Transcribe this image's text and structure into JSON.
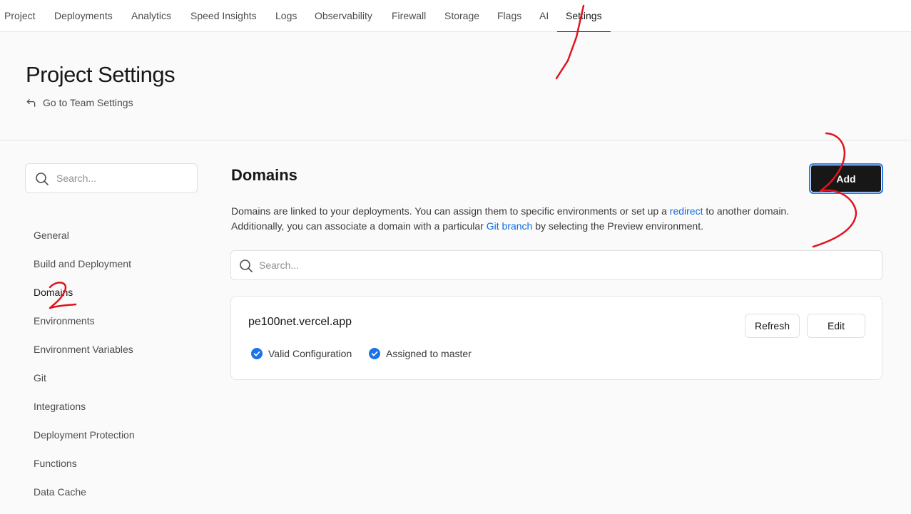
{
  "topnav": {
    "items": [
      {
        "label": "Project"
      },
      {
        "label": "Deployments"
      },
      {
        "label": "Analytics"
      },
      {
        "label": "Speed Insights"
      },
      {
        "label": "Logs"
      },
      {
        "label": "Observability"
      },
      {
        "label": "Firewall"
      },
      {
        "label": "Storage"
      },
      {
        "label": "Flags"
      },
      {
        "label": "AI"
      },
      {
        "label": "Settings",
        "active": true
      }
    ]
  },
  "header": {
    "title": "Project Settings",
    "team_link": "Go to Team Settings"
  },
  "sidebar": {
    "search_placeholder": "Search...",
    "items": [
      {
        "label": "General"
      },
      {
        "label": "Build and Deployment"
      },
      {
        "label": "Domains",
        "active": true
      },
      {
        "label": "Environments"
      },
      {
        "label": "Environment Variables"
      },
      {
        "label": "Git"
      },
      {
        "label": "Integrations"
      },
      {
        "label": "Deployment Protection"
      },
      {
        "label": "Functions"
      },
      {
        "label": "Data Cache"
      }
    ]
  },
  "main": {
    "title": "Domains",
    "add_label": "Add",
    "description": {
      "part1": "Domains are linked to your deployments. You can assign them to specific environments or set up a ",
      "link1": "redirect",
      "part2": " to another domain.",
      "part3": "Additionally, you can associate a domain with a particular ",
      "link2": "Git branch",
      "part4": " by selecting the Preview environment."
    },
    "search_placeholder": "Search...",
    "domains": [
      {
        "name": "pe100net.vercel.app",
        "status_valid": "Valid Configuration",
        "status_assigned": "Assigned to master",
        "refresh_label": "Refresh",
        "edit_label": "Edit"
      }
    ]
  },
  "colors": {
    "accent_link": "#0a6fe0",
    "check_blue": "#1a73e8",
    "annotation_red": "#e0141e",
    "button_dark": "#171717"
  }
}
